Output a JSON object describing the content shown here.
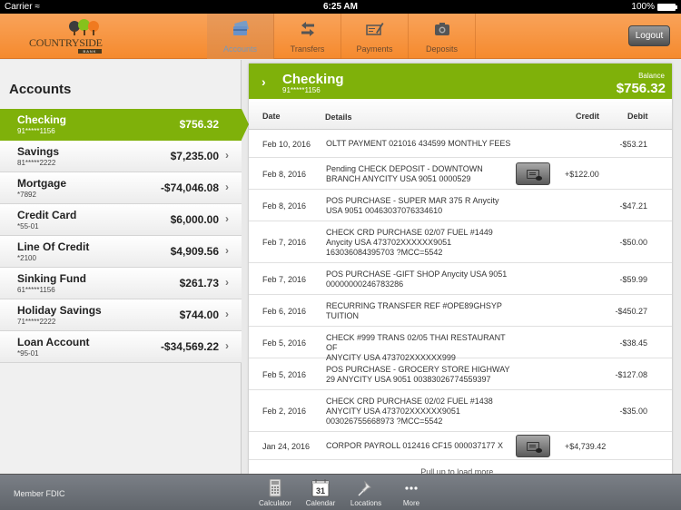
{
  "status_bar": {
    "carrier": "Carrier",
    "time": "6:25 AM",
    "battery": "100%"
  },
  "brand": {
    "name": "COUNTRYSIDE",
    "sub": "BANK",
    "tree_colors": [
      "#3d3d3d",
      "#86c21c",
      "#f07a20"
    ]
  },
  "colors": {
    "accent_orange": "#f58a2e",
    "accent_green": "#7fb10a",
    "footer_gray": "#6a6f75"
  },
  "nav": {
    "tabs": [
      {
        "label": "Accounts",
        "icon": "credit-card-icon",
        "active": true
      },
      {
        "label": "Transfers",
        "icon": "transfer-arrows-icon",
        "active": false
      },
      {
        "label": "Payments",
        "icon": "check-pen-icon",
        "active": false
      },
      {
        "label": "Deposits",
        "icon": "camera-icon",
        "active": false
      }
    ],
    "logout_label": "Logout"
  },
  "sidebar": {
    "title": "Accounts",
    "accounts": [
      {
        "name": "Checking",
        "number": "91*****1156",
        "balance": "$756.32",
        "active": true
      },
      {
        "name": "Savings",
        "number": "81*****2222",
        "balance": "$7,235.00"
      },
      {
        "name": "Mortgage",
        "number": "*7892",
        "balance": "-$74,046.08"
      },
      {
        "name": "Credit Card",
        "number": "*55-01",
        "balance": "$6,000.00"
      },
      {
        "name": "Line Of Credit",
        "number": "*2100",
        "balance": "$4,909.56"
      },
      {
        "name": "Sinking Fund",
        "number": "61*****1156",
        "balance": "$261.73"
      },
      {
        "name": "Holiday Savings",
        "number": "71*****2222",
        "balance": "$744.00"
      },
      {
        "name": "Loan Account",
        "number": "*95-01",
        "balance": "-$34,569.22"
      }
    ]
  },
  "detail": {
    "account_name": "Checking",
    "account_number": "91*****1156",
    "balance_label": "Balance",
    "balance": "$756.32",
    "columns": {
      "date": "Date",
      "details": "Details",
      "credit": "Credit",
      "debit": "Debit"
    },
    "transactions": [
      {
        "date": "Feb 10, 2016",
        "details": [
          "OLTT PAYMENT 021016 434599 MONTHLY FEES"
        ],
        "credit": "",
        "debit": "-$53.21",
        "has_image": false
      },
      {
        "date": "Feb 8, 2016",
        "details": [
          "Pending CHECK DEPOSIT - DOWNTOWN",
          "BRANCH ANYCITY USA 9051 0000529"
        ],
        "credit": "+$122.00",
        "debit": "",
        "has_image": true
      },
      {
        "date": "Feb 8, 2016",
        "details": [
          "POS PURCHASE -  SUPER MAR 375 R Anycity",
          "USA 9051 00463037076334610"
        ],
        "credit": "",
        "debit": "-$47.21",
        "has_image": false
      },
      {
        "date": "Feb 7, 2016",
        "details": [
          "CHECK CRD PURCHASE 02/07  FUEL #1449",
          "Anycity USA 473702XXXXXX9051",
          "163036084395703 ?MCC=5542"
        ],
        "credit": "",
        "debit": "-$50.00",
        "has_image": false
      },
      {
        "date": "Feb 7, 2016",
        "details": [
          "POS PURCHASE -GIFT SHOP Anycity USA 9051",
          "00000000246783286"
        ],
        "credit": "",
        "debit": "-$59.99",
        "has_image": false
      },
      {
        "date": "Feb 6, 2016",
        "details": [
          "RECURRING TRANSFER REF #OPE89GHSYP",
          "TUITION"
        ],
        "credit": "",
        "debit": "-$450.27",
        "has_image": false
      },
      {
        "date": "Feb 5, 2016",
        "details": [
          "CHECK #999 TRANS 02/05 THAI RESTAURANT OF",
          "ANYCITY USA 473702XXXXXX999"
        ],
        "credit": "",
        "debit": "-$38.45",
        "has_image": false
      },
      {
        "date": "Feb 5, 2016",
        "details": [
          "POS PURCHASE - GROCERY STORE HIGHWAY",
          "29 ANYCITY USA 9051 00383026774559397"
        ],
        "credit": "",
        "debit": "-$127.08",
        "has_image": false
      },
      {
        "date": "Feb 2, 2016",
        "details": [
          "CHECK CRD PURCHASE 02/02 FUEL #1438",
          "ANYCITY USA 473702XXXXXX9051",
          "003026755668973 ?MCC=5542"
        ],
        "credit": "",
        "debit": "-$35.00",
        "has_image": false
      },
      {
        "date": "Jan 24, 2016",
        "details": [
          "CORPOR PAYROLL 012416 CF15 000037177 X"
        ],
        "credit": "+$4,739.42",
        "debit": "",
        "has_image": true
      }
    ],
    "pull_text": "Pull up to load more..."
  },
  "footer": {
    "member_text": "Member FDIC",
    "tools": [
      {
        "label": "Calculator",
        "icon": "calculator-icon"
      },
      {
        "label": "Calendar",
        "icon": "calendar-icon",
        "day": "31"
      },
      {
        "label": "Locations",
        "icon": "pushpin-icon"
      },
      {
        "label": "More",
        "icon": "more-dots-icon"
      }
    ]
  }
}
